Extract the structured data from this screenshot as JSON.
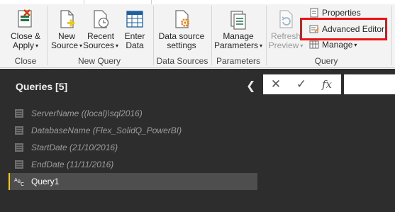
{
  "ribbon": {
    "close_apply": {
      "line1": "Close &",
      "line2": "Apply"
    },
    "new_source": {
      "line1": "New",
      "line2": "Source"
    },
    "recent_sources": {
      "line1": "Recent",
      "line2": "Sources"
    },
    "enter_data": {
      "line1": "Enter",
      "line2": "Data"
    },
    "data_source_settings": {
      "line1": "Data source",
      "line2": "settings"
    },
    "manage_parameters": {
      "line1": "Manage",
      "line2": "Parameters"
    },
    "refresh_preview": {
      "line1": "Refresh",
      "line2": "Preview"
    },
    "properties": "Properties",
    "advanced_editor": "Advanced Editor",
    "manage": "Manage",
    "groups": {
      "close": "Close",
      "new_query": "New Query",
      "data_sources": "Data Sources",
      "parameters": "Parameters",
      "query": "Query"
    }
  },
  "queries": {
    "header": "Queries [5]",
    "items": [
      {
        "label": "ServerName ((local)\\sql2016)",
        "icon": "parameter-icon"
      },
      {
        "label": "DatabaseName (Flex_SolidQ_PowerBI)",
        "icon": "parameter-icon"
      },
      {
        "label": "StartDate (21/10/2016)",
        "icon": "parameter-icon"
      },
      {
        "label": "EndDate (11/11/2016)",
        "icon": "parameter-icon"
      },
      {
        "label": "Query1",
        "icon": "abc-icon"
      }
    ]
  },
  "formula_bar": {
    "cancel": "✕",
    "commit": "✓",
    "fx": "fx"
  },
  "colors": {
    "highlight": "#ee1111",
    "pane_bg": "#2d2d2d",
    "accent": "#f2c811"
  }
}
